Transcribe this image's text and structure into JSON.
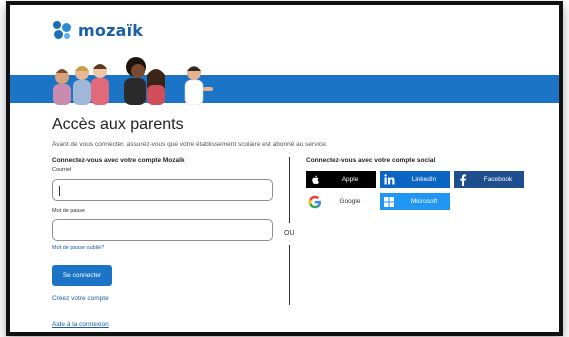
{
  "brand": {
    "name": "mozaïk"
  },
  "page": {
    "title": "Accès aux parents",
    "intro": "Avant de vous connecter, assurez-vous que votre établissement scolaire est abonné au service."
  },
  "left_panel": {
    "heading": "Connectez-vous avec votre compte Mozaïk",
    "email_label": "Courriel",
    "email_value": "",
    "password_label": "Mot de passe",
    "password_value": "",
    "forgot_link": "Mot de passe oublié?",
    "login_button": "Se connecter",
    "create_link": "Créez votre compte",
    "help_link": "Aide à la connexion"
  },
  "separator": "OU",
  "right_panel": {
    "heading": "Connectez-vous avec votre compte social",
    "providers": [
      {
        "label": "Apple",
        "icon": "apple-icon",
        "color": "#000000"
      },
      {
        "label": "LinkedIn",
        "icon": "linkedin-icon",
        "color": "#0a66c2"
      },
      {
        "label": "Facebook",
        "icon": "facebook-icon",
        "color": "#1f4e8f"
      },
      {
        "label": "Google",
        "icon": "google-icon",
        "color": "#ffffff"
      },
      {
        "label": "Microsoft",
        "icon": "microsoft-icon",
        "color": "#2196f3"
      }
    ]
  },
  "colors": {
    "accent": "#1b74c6",
    "brand_text": "#1a5fa8"
  }
}
